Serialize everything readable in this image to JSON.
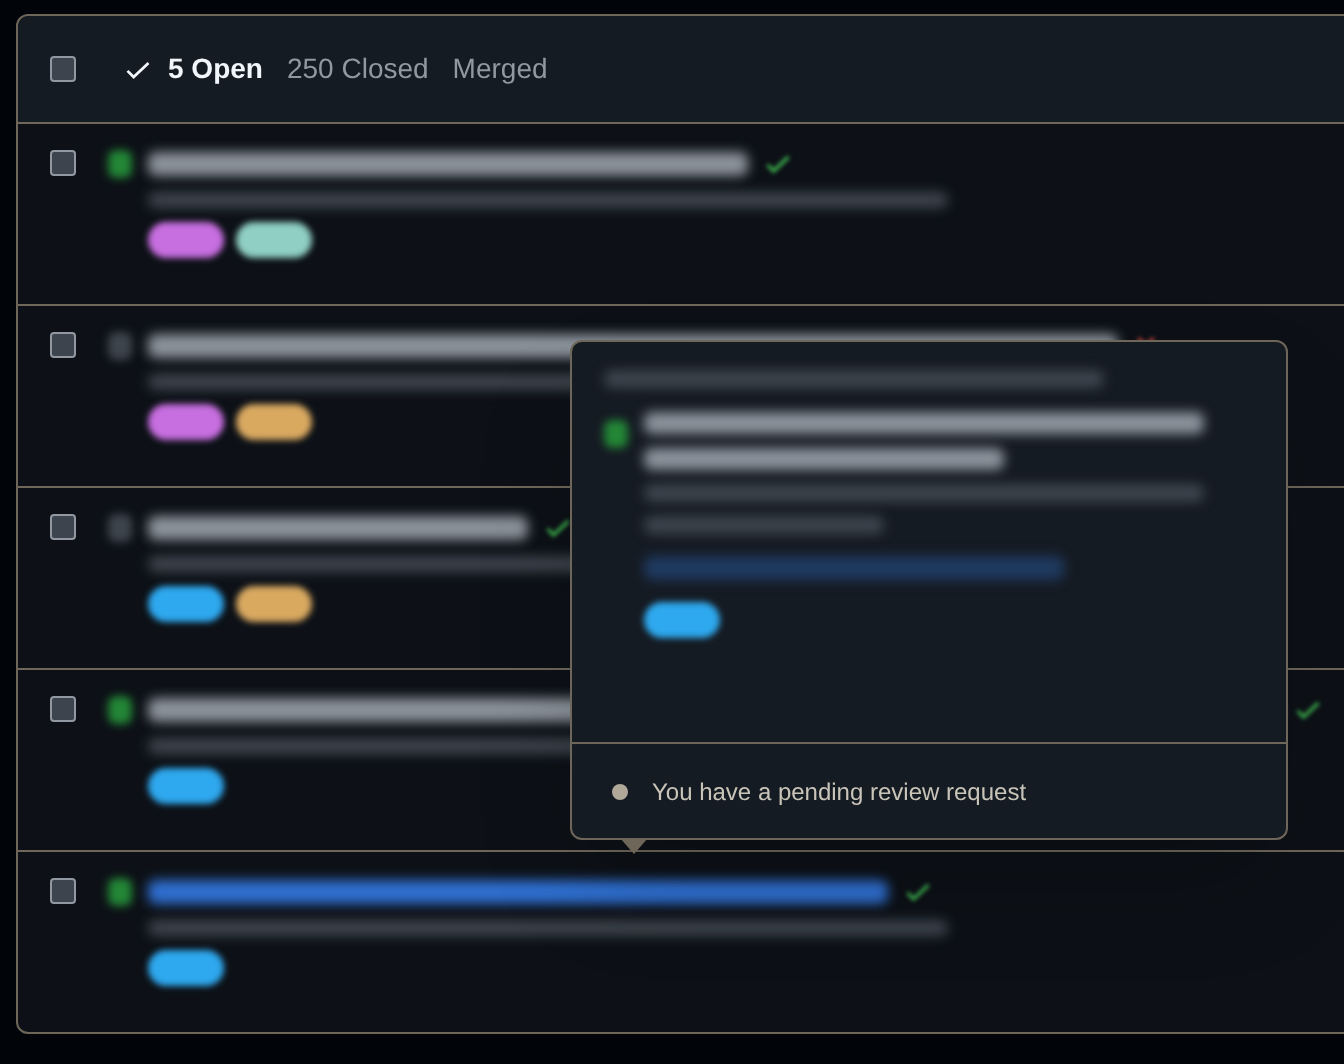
{
  "filter_bar": {
    "select_all": {
      "checked": false
    },
    "tabs": [
      {
        "label": "5 Open",
        "selected": true
      },
      {
        "label": "250 Closed",
        "selected": false
      },
      {
        "label": "Merged",
        "selected": false
      }
    ]
  },
  "pull_requests": [
    {
      "checked": false,
      "draft": false,
      "link": false,
      "checks_passed": true,
      "labels": [
        {
          "color": "#c76ee0"
        },
        {
          "color": "#8fcfc4"
        }
      ]
    },
    {
      "checked": false,
      "draft": true,
      "link": false,
      "checks_passed": false,
      "labels": [
        {
          "color": "#c76ee0"
        },
        {
          "color": "#d9a960"
        }
      ]
    },
    {
      "checked": false,
      "draft": true,
      "link": false,
      "checks_passed": true,
      "labels": [
        {
          "color": "#2ea8ee"
        },
        {
          "color": "#d9a960"
        }
      ]
    },
    {
      "checked": false,
      "draft": false,
      "link": false,
      "checks_passed": true,
      "labels": [
        {
          "color": "#2ea8ee"
        }
      ]
    },
    {
      "checked": false,
      "draft": false,
      "link": true,
      "checks_passed": true,
      "labels": [
        {
          "color": "#2ea8ee"
        }
      ]
    }
  ],
  "hovercard": {
    "labels": [
      {
        "color": "#2ea8ee"
      }
    ],
    "notice": "You have a pending review request"
  }
}
